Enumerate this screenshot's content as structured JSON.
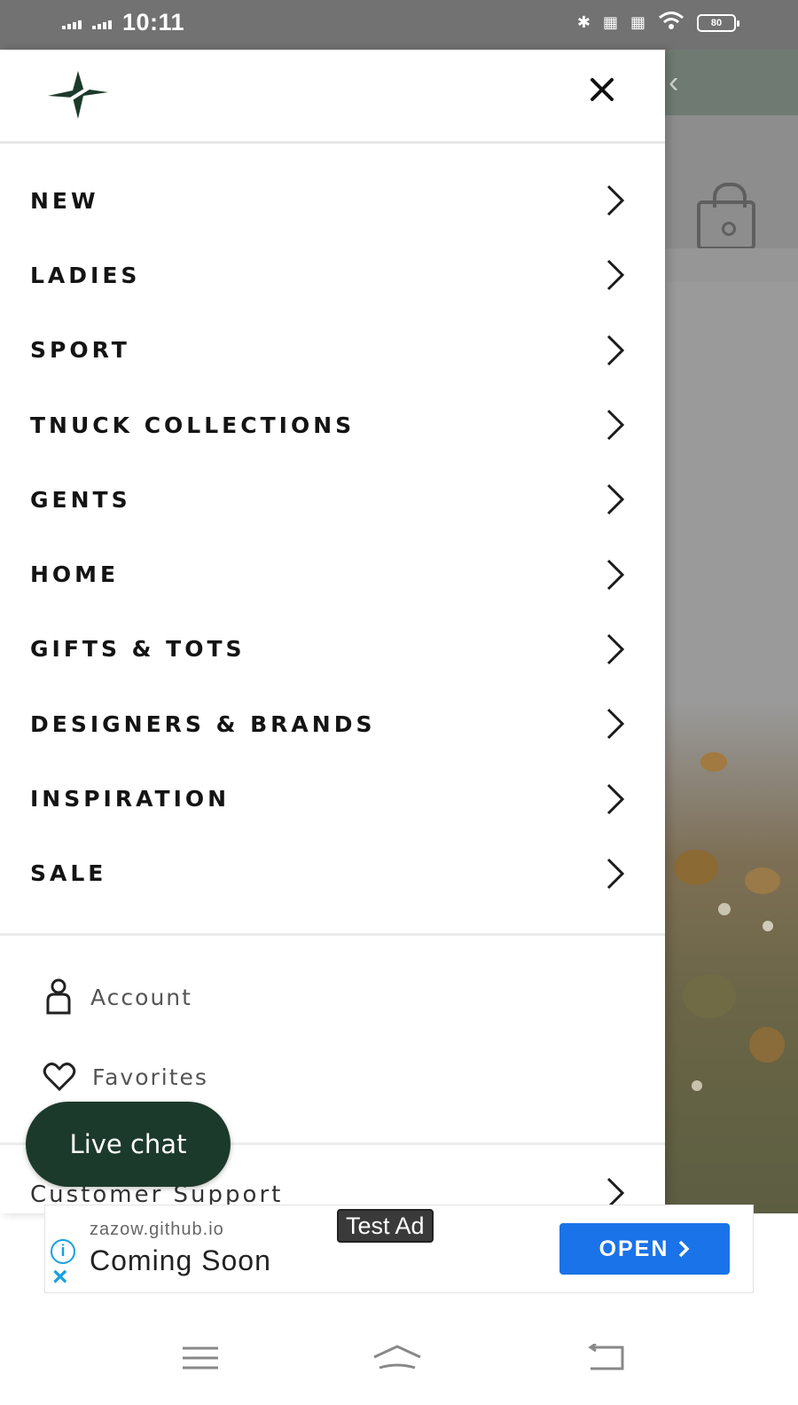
{
  "status_bar": {
    "time": "10:11",
    "battery": "80"
  },
  "drawer": {
    "menu_items": [
      {
        "label": "NEW"
      },
      {
        "label": "LADIES"
      },
      {
        "label": "SPORT"
      },
      {
        "label": "TNUCK COLLECTIONS"
      },
      {
        "label": "GENTS"
      },
      {
        "label": "HOME"
      },
      {
        "label": "GIFTS & TOTS"
      },
      {
        "label": "DESIGNERS & BRANDS"
      },
      {
        "label": "INSPIRATION"
      },
      {
        "label": "SALE"
      }
    ],
    "account_label": "Account",
    "favorites_label": "Favorites",
    "support_label": "Customer Support"
  },
  "live_chat": {
    "label": "Live chat"
  },
  "ad": {
    "tag": "Test Ad",
    "url": "zazow.github.io",
    "title": "Coming Soon",
    "cta": "OPEN"
  },
  "colors": {
    "accent": "#1c3a2b",
    "ad_button": "#1a73e8",
    "status_bar": "#727272"
  }
}
